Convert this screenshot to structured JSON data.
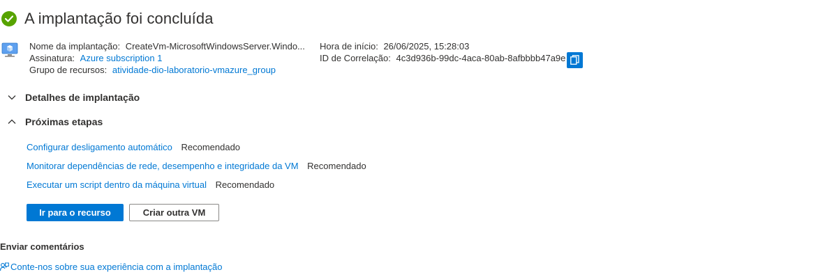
{
  "header": {
    "title": "A implantação foi concluída",
    "status_icon": "check-circle-icon",
    "status_color": "#57a300"
  },
  "details": {
    "deployment_name_label": "Nome da implantação:",
    "deployment_name_value": "CreateVm-MicrosoftWindowsServer.Windo...",
    "subscription_label": "Assinatura:",
    "subscription_value": "Azure subscription 1",
    "resource_group_label": "Grupo de recursos:",
    "resource_group_value": "atividade-dio-laboratorio-vmazure_group",
    "start_time_label": "Hora de início:",
    "start_time_value": "26/06/2025, 15:28:03",
    "correlation_label": "ID de Correlação:",
    "correlation_value": "4c3d936b-99dc-4aca-80ab-8afbbbb47a9e"
  },
  "sections": {
    "deployment_details": "Detalhes de implantação",
    "next_steps": "Próximas etapas"
  },
  "next_steps": [
    {
      "link": "Configurar desligamento automático",
      "tag": "Recomendado"
    },
    {
      "link": "Monitorar dependências de rede, desempenho e integridade da VM",
      "tag": "Recomendado"
    },
    {
      "link": "Executar um script dentro da máquina virtual",
      "tag": "Recomendado"
    }
  ],
  "buttons": {
    "go_to_resource": "Ir para o recurso",
    "create_another_vm": "Criar outra VM"
  },
  "feedback": {
    "title": "Enviar comentários",
    "link": "Conte-nos sobre sua experiência com a implantação"
  },
  "colors": {
    "accent": "#0078d4",
    "text": "#323130"
  }
}
